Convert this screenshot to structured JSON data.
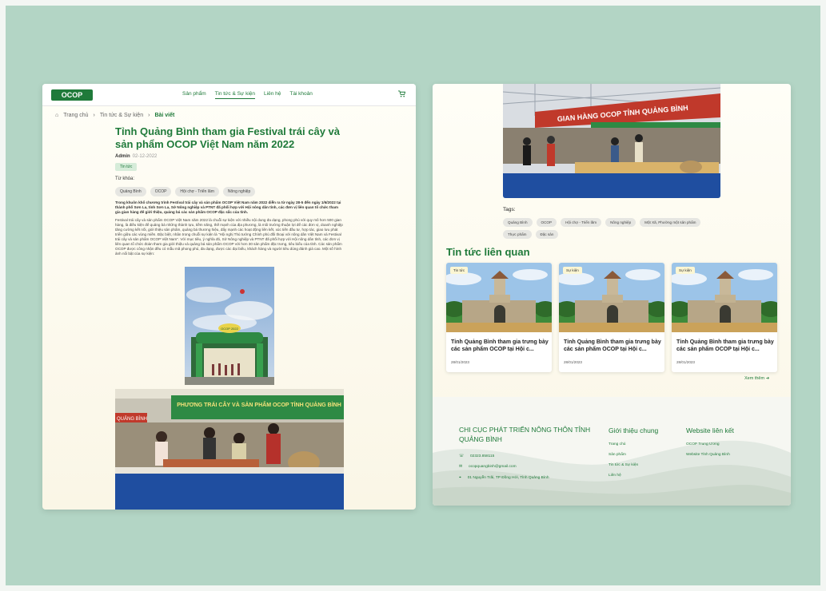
{
  "left": {
    "logo": "OCOP",
    "nav": [
      "Sản phẩm",
      "Tin tức & Sự kiện",
      "Liên hệ",
      "Tài khoản"
    ],
    "breadcrumb": [
      "Trang chủ",
      "Tin tức & Sự kiện",
      "Bài viết"
    ],
    "title": "Tỉnh Quảng Bình tham gia Festival trái cây và sản phẩm OCOP Việt Nam năm 2022",
    "author": "Admin",
    "date": "02-12-2022",
    "category": "Tin tức",
    "keywords_label": "Từ khóa:",
    "keywords": [
      "Quảng Bình",
      "OCOP",
      "Hội chợ - Triển lãm",
      "Nông nghiệp"
    ],
    "lead": "Trong khuôn khổ chương trình Festival trái cây và sản phẩm OCOP Việt Nam năm 2022 diễn ra từ ngày 28-5 đến ngày 1/6/2022 tại thành phố Sơn La, tỉnh Sơn La, Sở Nông nghiệp và PTNT đã phối hợp với Hội nông dân tỉnh, các đơn vị liên quan tổ chức tham gia gian hàng để giới thiệu, quảng bá các sản phẩm OCOP đặc sắc của tỉnh.",
    "body": "Festival trái cây và sản phẩm OCOP Việt Nam năm 2022 là chuỗi sự kiện với nhiều nội dung đa dạng, phong phú với quy mô hơn 500 gian hàng, là điều kiện để quảng bá những thành tựu, tiềm năng, thế mạnh của địa phương, là môi trường thuận lợi để các đơn vị, doanh nghiệp tăng cường kết nối, giới thiệu sản phẩm, quảng bá thương hiệu, đẩy mạnh các hoạt động liên kết, xúc tiến đầu tư, hợp tác, giao lưu phát triển giữa các vùng miền. Đặc biệt, nhân trong chuỗi sự kiện là \"Hội nghị Thủ tướng Chính phủ đối thoại với nông dân Việt Nam và Festival trái cây và sản phẩm OCOP Việt Nam\". Với mục tiêu, ý nghĩa đó, Sở Nông nghiệp và PTNT đã phối hợp với Hội nông dân tỉnh, các đơn vị liên quan tổ chức đoàn tham gia giới thiệu và quảng bá sản phẩm OCOP với hơn 30 sản phẩm đặc trưng, tiêu biểu của tỉnh. Các sản phẩm OCOP được công nhận đều có mẫu mã phong phú, đa dạng, được các đại biểu, khách hàng và người tiêu dùng đánh giá cao. Một số hình ảnh nổi bật của sự kiện:",
    "gate_sign": "OCOP 2022",
    "booth_banner": "PHƯƠNG TRÁI CÂY VÀ SẢN PHẨM OCOP TỈNH QUẢNG BÌNH",
    "booth_side": "QUẢNG BÌNH"
  },
  "right": {
    "booth_banner": "GIAN HÀNG OCOP TỈNH QUẢNG BÌNH",
    "tags_label": "Tags:",
    "tags": [
      "Quảng Bình",
      "OCOP",
      "Hội chợ - Triển lãm",
      "Nông nghiệp",
      "Một Xã, Phường một sản phẩm",
      "Thực phẩm",
      "Đặc sản"
    ],
    "related_title": "Tin tức liên quan",
    "cards": [
      {
        "badge": "Tin tức",
        "title": "Tỉnh Quảng Bình tham gia trưng bày các sản phẩm OCOP tại Hội c...",
        "date": "28/01/2023"
      },
      {
        "badge": "Sự kiện",
        "title": "Tỉnh Quảng Bình tham gia trưng bày các sản phẩm OCOP tại Hội c...",
        "date": "28/01/2023"
      },
      {
        "badge": "Sự kiện",
        "title": "Tỉnh Quảng Bình tham gia trưng bày các sản phẩm OCOP tại Hội c...",
        "date": "28/01/2023"
      }
    ],
    "more": "Xem thêm",
    "footer": {
      "org": "CHI CỤC PHÁT TRIỂN NÔNG THÔN TỈNH QUẢNG BÌNH",
      "phone": "02323.858115",
      "email": "ocopquangbinh@gmail.com",
      "address": "01 Nguyễn Trãi, TP Đồng Hới, Tỉnh Quảng Bình",
      "col1_title": "Giới thiệu chung",
      "col1_links": [
        "Trang chủ",
        "Sản phẩm",
        "Tin tức & Sự kiện",
        "Liên hệ"
      ],
      "col2_title": "Website liên kết",
      "col2_links": [
        "OCOP Trung Ương",
        "Website Tỉnh Quảng Bình"
      ]
    }
  },
  "colors": {
    "brand": "#1f7a3a",
    "background": "#b3d5c5",
    "chip": "#e6e6e2",
    "category_bg": "#d6ecd9"
  }
}
